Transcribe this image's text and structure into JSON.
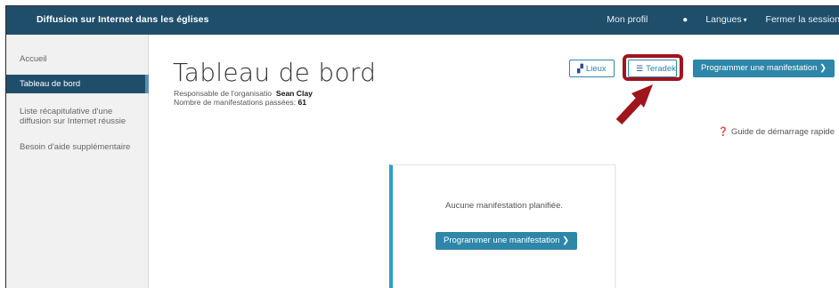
{
  "header": {
    "brand": "Diffusion sur Internet dans les églises",
    "profile": "Mon profil",
    "languages": "Langues",
    "logout": "Fermer la session"
  },
  "sidebar": {
    "items": [
      {
        "label": "Accueil"
      },
      {
        "label": "Tableau de bord"
      },
      {
        "label_line1": "Liste récapitulative d'une",
        "label_line2": "diffusion sur Internet réussie"
      },
      {
        "label": "Besoin d'aide supplémentaire"
      }
    ]
  },
  "main": {
    "title": "Tableau de bord",
    "organizer_label": "Responsable de l'organisatio",
    "organizer_name": "Sean Clay",
    "past_events_label": "Nombre de manifestations passées:",
    "past_events_count": "61",
    "buttons": {
      "venues": "Lieux",
      "teradek": "Teradek",
      "schedule": "Programmer une manifestation"
    },
    "guide": "Guide de démarrage rapide",
    "empty_message": "Aucune manifestation planifiée.",
    "empty_schedule": "Programmer une manifestation"
  },
  "colors": {
    "topbar": "#1f4e6b",
    "accent": "#2e86a8",
    "highlight": "#a0141c"
  }
}
